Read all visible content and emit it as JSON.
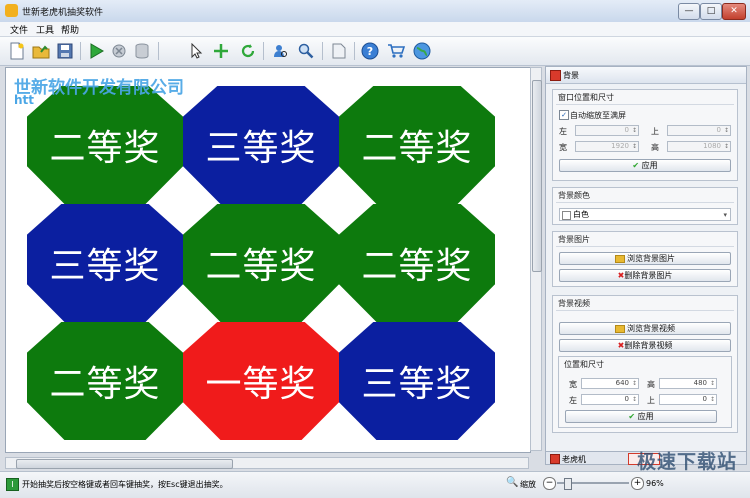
{
  "window": {
    "title": "世新老虎机抽奖软件",
    "min": "—",
    "max": "□",
    "close": "✕"
  },
  "menu": [
    "文件",
    "工具",
    "帮助"
  ],
  "toolbar": [
    "new-file",
    "open-folder",
    "save",
    "play",
    "settings",
    "database",
    "pointer",
    "move-cross",
    "refresh",
    "user-search",
    "user-zoom",
    "document",
    "help",
    "cart",
    "globe"
  ],
  "watermark": {
    "line1": "世新软件开发有限公司",
    "line2": "htt"
  },
  "tiles": [
    {
      "label": "二等奖",
      "color": "#0d7a0d"
    },
    {
      "label": "三等奖",
      "color": "#0b1fa0"
    },
    {
      "label": "二等奖",
      "color": "#0d7a0d"
    },
    {
      "label": "三等奖",
      "color": "#0b1fa0"
    },
    {
      "label": "二等奖",
      "color": "#0d7a0d"
    },
    {
      "label": "二等奖",
      "color": "#0d7a0d"
    },
    {
      "label": "二等奖",
      "color": "#0d7a0d"
    },
    {
      "label": "一等奖",
      "color": "#f01b1b"
    },
    {
      "label": "三等奖",
      "color": "#0b1fa0"
    }
  ],
  "panel": {
    "header": "背景",
    "window_group": {
      "title": "窗口位置和尺寸",
      "auto_scale_label": "自动缩放至满屏",
      "auto_scale_checked": "✓",
      "left_label": "左",
      "left_value": "0",
      "top_label": "上",
      "top_value": "0",
      "width_label": "宽",
      "width_value": "1920",
      "height_label": "高",
      "height_value": "1080",
      "apply": "应用"
    },
    "color_group": {
      "title": "背景颜色",
      "value": "白色"
    },
    "image_group": {
      "title": "背景图片",
      "browse": "浏览背景图片",
      "delete": "删除背景图片"
    },
    "video_group": {
      "title": "背景视频",
      "browse": "浏览背景视频",
      "delete": "删除背景视频",
      "sub_title": "位置和尺寸",
      "width_label": "宽",
      "width_value": "640",
      "height_label": "高",
      "height_value": "480",
      "left_label": "左",
      "left_value": "0",
      "top_label": "上",
      "top_value": "0",
      "apply": "应用"
    },
    "bottom_tab": "老虎机"
  },
  "status": {
    "message": "开始抽奖后按空格键或者回车键抽奖，按Esc键退出抽奖。",
    "zoom_label": "缩放",
    "zoom_value": "96%",
    "brand": "极速下载站"
  }
}
